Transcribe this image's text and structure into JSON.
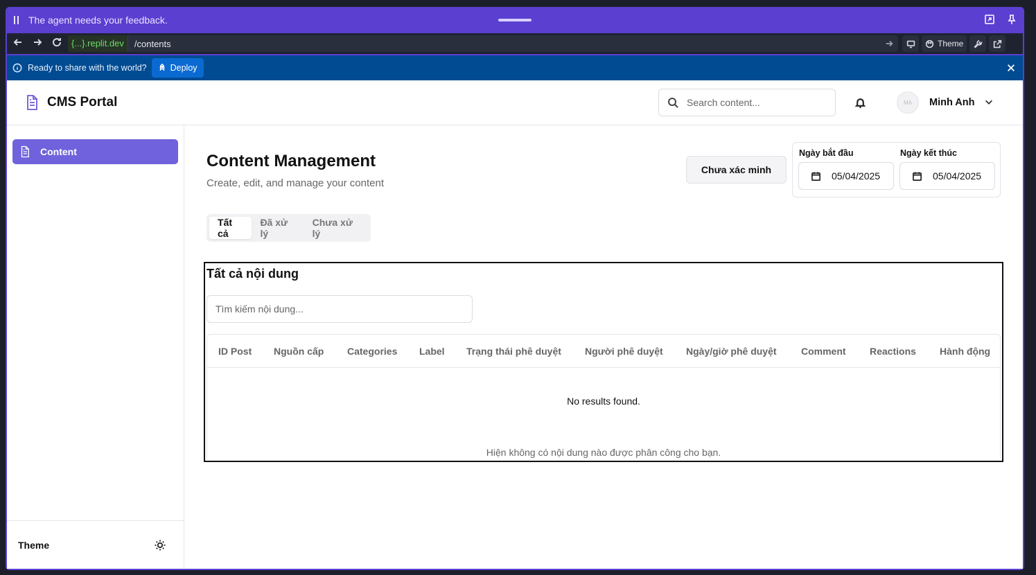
{
  "agent_bar": {
    "message": "The agent needs your feedback."
  },
  "browser": {
    "host": "{...}.replit.dev",
    "path": "/contents",
    "theme_label": "Theme"
  },
  "deploy_bar": {
    "message": "Ready to share with the world?",
    "deploy_label": "Deploy"
  },
  "header": {
    "brand": "CMS Portal",
    "search_placeholder": "Search content...",
    "avatar_initials": "MA",
    "user_name": "Minh Anh"
  },
  "sidebar": {
    "items": [
      {
        "label": "Content"
      }
    ],
    "footer_label": "Theme"
  },
  "main": {
    "title": "Content Management",
    "subtitle": "Create, edit, and manage your content",
    "verify_button": "Chưa xác minh",
    "start_date_label": "Ngày bắt đầu",
    "start_date": "05/04/2025",
    "end_date_label": "Ngày kết thúc",
    "end_date": "05/04/2025",
    "tabs": [
      {
        "label": "Tất cả"
      },
      {
        "label": "Đã xử lý"
      },
      {
        "label": "Chưa xử lý"
      }
    ],
    "card_title": "Tất cả nội dung",
    "filter_placeholder": "Tìm kiếm nội dung...",
    "columns": [
      "ID Post",
      "Nguồn cấp",
      "Categories",
      "Label",
      "Trạng thái phê duyệt",
      "Người phê duyệt",
      "Ngày/giờ phê duyệt",
      "Comment",
      "Reactions",
      "Hành động"
    ],
    "empty_text": "No results found.",
    "caption": "Hiện không có nội dung nào được phân công cho bạn."
  },
  "colors": {
    "accent": "#6f62dc",
    "agent_bar": "#5b3fd0",
    "deploy_bar": "#004b91"
  }
}
